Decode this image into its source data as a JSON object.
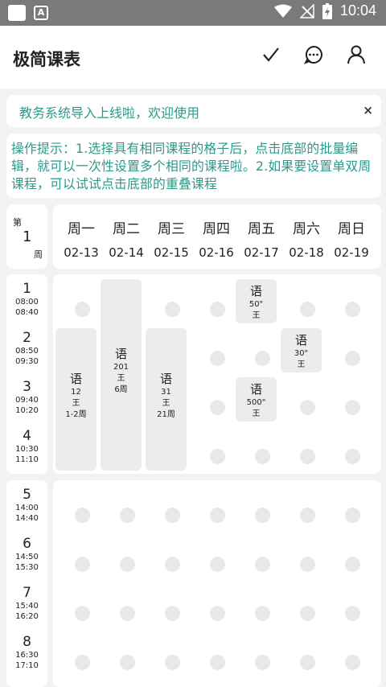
{
  "status_bar": {
    "time": "10:04",
    "icons": [
      "app-square-icon",
      "a-notification-icon",
      "wifi-icon",
      "no-signal-icon",
      "battery-charging-icon"
    ]
  },
  "app": {
    "title": "极简课表",
    "actions": [
      "check-icon",
      "chat-icon",
      "user-icon"
    ]
  },
  "notice": {
    "text": "教务系统导入上线啦，欢迎使用",
    "close": "×"
  },
  "tip": {
    "text": "操作提示：1.选择具有相同课程的格子后，点击底部的批量编辑，就可以一次性设置多个相同的课程啦。2.如果要设置单双周课程，可以试试点击底部的重叠课程"
  },
  "week": {
    "prefix": "第",
    "number": "1",
    "suffix": "周"
  },
  "days": [
    {
      "name": "周一",
      "date": "02-13"
    },
    {
      "name": "周二",
      "date": "02-14"
    },
    {
      "name": "周三",
      "date": "02-15"
    },
    {
      "name": "周四",
      "date": "02-16"
    },
    {
      "name": "周五",
      "date": "02-17"
    },
    {
      "name": "周六",
      "date": "02-18"
    },
    {
      "name": "周日",
      "date": "02-19"
    }
  ],
  "slots": [
    {
      "num": "1",
      "start": "08:00",
      "end": "08:40"
    },
    {
      "num": "2",
      "start": "08:50",
      "end": "09:30"
    },
    {
      "num": "3",
      "start": "09:40",
      "end": "10:20"
    },
    {
      "num": "4",
      "start": "10:30",
      "end": "11:10"
    },
    {
      "num": "5",
      "start": "14:00",
      "end": "14:40"
    },
    {
      "num": "6",
      "start": "14:50",
      "end": "15:30"
    },
    {
      "num": "7",
      "start": "15:40",
      "end": "16:20"
    },
    {
      "num": "8",
      "start": "16:30",
      "end": "17:10"
    }
  ],
  "courses": [
    {
      "day": 1,
      "from": 2,
      "to": 4,
      "name": "语",
      "room": "12",
      "teacher": "王",
      "weeks": "1-2周"
    },
    {
      "day": 2,
      "from": 1,
      "to": 4,
      "name": "语",
      "room": "201",
      "teacher": "王",
      "weeks": "6周"
    },
    {
      "day": 3,
      "from": 2,
      "to": 4,
      "name": "语",
      "room": "31",
      "teacher": "王",
      "weeks": "21周"
    },
    {
      "day": 5,
      "from": 1,
      "to": 1,
      "name": "语",
      "room": "50\"",
      "teacher": "王",
      "weeks": ""
    },
    {
      "day": 6,
      "from": 2,
      "to": 2,
      "name": "语",
      "room": "30\"",
      "teacher": "王",
      "weeks": ""
    },
    {
      "day": 5,
      "from": 3,
      "to": 3,
      "name": "语",
      "room": "500\"",
      "teacher": "王",
      "weeks": ""
    }
  ]
}
